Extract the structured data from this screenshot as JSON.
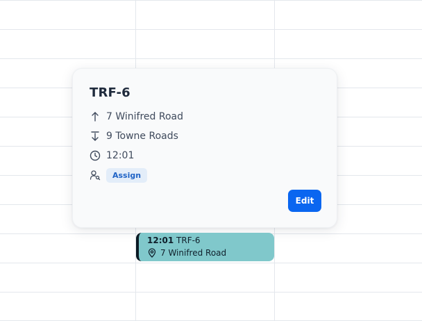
{
  "popover": {
    "title": "TRF-6",
    "from_address": "7 Winifred Road",
    "to_address": "9 Towne Roads",
    "time": "12:01",
    "assign_label": "Assign",
    "edit_label": "Edit",
    "icons": {
      "from": "arrow-up-icon",
      "to": "arrow-down-icon",
      "time": "clock-icon",
      "assign": "user-search-icon"
    }
  },
  "event": {
    "time": "12:01",
    "code": "TRF-6",
    "location": "7 Winifred Road",
    "icon": "map-pin-icon"
  },
  "colors": {
    "grid_line": "#e3e7ec",
    "card_background": "#f9fafb",
    "title_text": "#1f2a3c",
    "body_text": "#3f4a5c",
    "assign_badge_bg": "#e3edf9",
    "assign_badge_text": "#1f63c6",
    "edit_button_bg": "#0a66f0",
    "event_background": "#80c8cb",
    "event_accent": "#0b1a24"
  }
}
